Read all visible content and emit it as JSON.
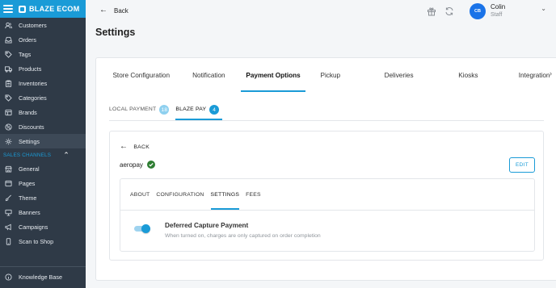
{
  "app": {
    "brand": "BLAZE ECOM"
  },
  "sidebar": {
    "items": [
      {
        "label": "Customers",
        "icon": "users-icon"
      },
      {
        "label": "Orders",
        "icon": "inbox-icon"
      },
      {
        "label": "Tags",
        "icon": "tag-icon"
      },
      {
        "label": "Products",
        "icon": "truck-icon"
      },
      {
        "label": "Inventories",
        "icon": "clipboard-icon"
      },
      {
        "label": "Categories",
        "icon": "tag-icon"
      },
      {
        "label": "Brands",
        "icon": "layers-icon"
      },
      {
        "label": "Discounts",
        "icon": "percent-icon"
      },
      {
        "label": "Settings",
        "icon": "gear-icon",
        "active": true
      }
    ],
    "section_label": "SALES CHANNELS",
    "channel_items": [
      {
        "label": "General",
        "icon": "store-icon"
      },
      {
        "label": "Pages",
        "icon": "pages-icon"
      },
      {
        "label": "Theme",
        "icon": "brush-icon"
      },
      {
        "label": "Banners",
        "icon": "banner-icon"
      },
      {
        "label": "Campaigns",
        "icon": "megaphone-icon"
      },
      {
        "label": "Scan to Shop",
        "icon": "phone-icon"
      }
    ],
    "footer_label": "Knowledge Base"
  },
  "header": {
    "back_label": "Back",
    "user_name": "Colin",
    "user_role": "Staff",
    "user_initials": "CB"
  },
  "page": {
    "title": "Settings"
  },
  "tabs": [
    {
      "label": "Store Configuration",
      "active": false
    },
    {
      "label": "Notification",
      "active": false
    },
    {
      "label": "Payment Options",
      "active": true
    },
    {
      "label": "Pickup",
      "active": false
    },
    {
      "label": "Deliveries",
      "active": false
    },
    {
      "label": "Kiosks",
      "active": false
    },
    {
      "label": "Integration",
      "active": false
    }
  ],
  "payment_tabs": [
    {
      "label": "LOCAL PAYMENT",
      "count": "18"
    },
    {
      "label": "BLAZE PAY",
      "count": "4"
    }
  ],
  "detail": {
    "back_label": "BACK",
    "provider_name": "aeropay",
    "edit_label": "EDIT",
    "tabs": [
      "ABOUT",
      "CONFIGURATION",
      "SETTINGS",
      "FEES"
    ],
    "active_tab": "SETTINGS"
  },
  "setting": {
    "title": "Deferred Capture Payment",
    "description": "When turned on, charges are only captured on order completion",
    "enabled": true
  },
  "colors": {
    "accent": "#1a9bd7",
    "sidebar_bg": "#2f3a47",
    "avatar": "#1a73e8",
    "success": "#2e7d32"
  }
}
